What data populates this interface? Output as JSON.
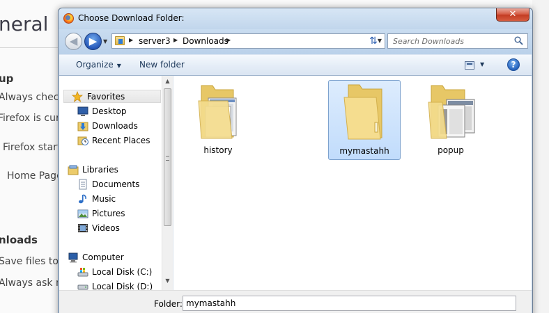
{
  "background": {
    "title": "neral",
    "section1_heading": "up",
    "line1": "Always check",
    "line2": "Firefox is curr",
    "line3": "Firefox start",
    "line4": "Home Page",
    "section2_heading": "nloads",
    "line5": "Save files to",
    "line6": "Always ask m"
  },
  "dialog": {
    "title": "Choose Download Folder:",
    "close_label": "✕",
    "breadcrumb": [
      "server3",
      "Downloads"
    ],
    "search_placeholder": "Search Downloads",
    "toolbar": {
      "organize_label": "Organize",
      "new_folder_label": "New folder"
    },
    "nav": {
      "favorites_label": "Favorites",
      "desktop_label": "Desktop",
      "downloads_label": "Downloads",
      "recent_label": "Recent Places",
      "libraries_label": "Libraries",
      "documents_label": "Documents",
      "music_label": "Music",
      "pictures_label": "Pictures",
      "videos_label": "Videos",
      "computer_label": "Computer",
      "disk_c_label": "Local Disk (C:)",
      "disk_d_label": "Local Disk (D:)"
    },
    "folders": [
      {
        "name": "history"
      },
      {
        "name": "mymastahh"
      },
      {
        "name": "popup"
      }
    ],
    "folder_field_label": "Folder:",
    "folder_field_value": "mymastahh"
  }
}
